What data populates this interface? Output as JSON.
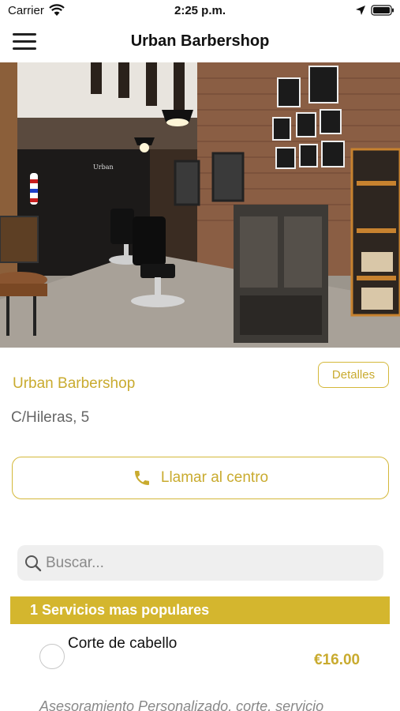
{
  "status_bar": {
    "carrier": "Carrier",
    "time": "2:25 p.m.",
    "icons": [
      "wifi-icon",
      "location-arrow-icon",
      "battery-icon"
    ]
  },
  "nav": {
    "title": "Urban Barbershop",
    "menu_icon": "hamburger-menu-icon"
  },
  "hero": {
    "image": "barbershop-interior-photo",
    "sign_text": "Urban"
  },
  "shop": {
    "name": "Urban Barbershop",
    "details_label": "Detalles",
    "address": "C/Hileras, 5",
    "call_label": "Llamar al centro",
    "call_icon": "phone-icon"
  },
  "search": {
    "placeholder": "Buscar...",
    "value": "",
    "icon": "search-icon"
  },
  "services": {
    "section_title": "1 Servicios mas populares",
    "items": [
      {
        "name": "Corte de cabello",
        "price": "€16.00",
        "description": "Asesoramiento Personalizado, corte, servicio"
      }
    ]
  },
  "colors": {
    "accent": "#c9ab2f",
    "section_bg": "#d4b62e",
    "search_bg": "#efefef"
  }
}
